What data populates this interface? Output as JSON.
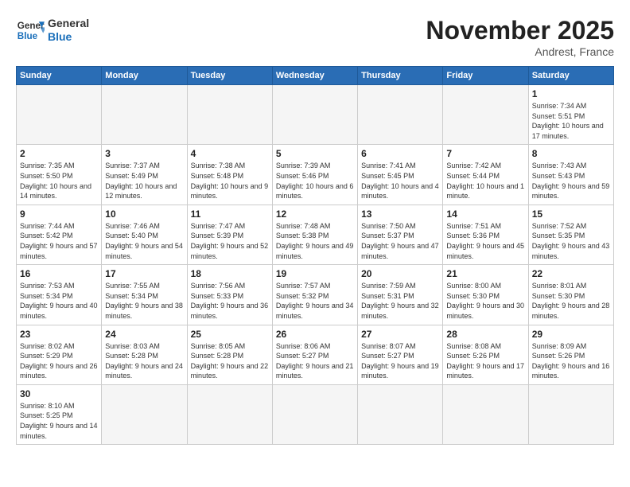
{
  "header": {
    "logo_line1": "General",
    "logo_line2": "Blue",
    "month": "November 2025",
    "location": "Andrest, France"
  },
  "weekdays": [
    "Sunday",
    "Monday",
    "Tuesday",
    "Wednesday",
    "Thursday",
    "Friday",
    "Saturday"
  ],
  "weeks": [
    [
      {
        "day": "",
        "info": ""
      },
      {
        "day": "",
        "info": ""
      },
      {
        "day": "",
        "info": ""
      },
      {
        "day": "",
        "info": ""
      },
      {
        "day": "",
        "info": ""
      },
      {
        "day": "",
        "info": ""
      },
      {
        "day": "1",
        "info": "Sunrise: 7:34 AM\nSunset: 5:51 PM\nDaylight: 10 hours and 17 minutes."
      }
    ],
    [
      {
        "day": "2",
        "info": "Sunrise: 7:35 AM\nSunset: 5:50 PM\nDaylight: 10 hours and 14 minutes."
      },
      {
        "day": "3",
        "info": "Sunrise: 7:37 AM\nSunset: 5:49 PM\nDaylight: 10 hours and 12 minutes."
      },
      {
        "day": "4",
        "info": "Sunrise: 7:38 AM\nSunset: 5:48 PM\nDaylight: 10 hours and 9 minutes."
      },
      {
        "day": "5",
        "info": "Sunrise: 7:39 AM\nSunset: 5:46 PM\nDaylight: 10 hours and 6 minutes."
      },
      {
        "day": "6",
        "info": "Sunrise: 7:41 AM\nSunset: 5:45 PM\nDaylight: 10 hours and 4 minutes."
      },
      {
        "day": "7",
        "info": "Sunrise: 7:42 AM\nSunset: 5:44 PM\nDaylight: 10 hours and 1 minute."
      },
      {
        "day": "8",
        "info": "Sunrise: 7:43 AM\nSunset: 5:43 PM\nDaylight: 9 hours and 59 minutes."
      }
    ],
    [
      {
        "day": "9",
        "info": "Sunrise: 7:44 AM\nSunset: 5:42 PM\nDaylight: 9 hours and 57 minutes."
      },
      {
        "day": "10",
        "info": "Sunrise: 7:46 AM\nSunset: 5:40 PM\nDaylight: 9 hours and 54 minutes."
      },
      {
        "day": "11",
        "info": "Sunrise: 7:47 AM\nSunset: 5:39 PM\nDaylight: 9 hours and 52 minutes."
      },
      {
        "day": "12",
        "info": "Sunrise: 7:48 AM\nSunset: 5:38 PM\nDaylight: 9 hours and 49 minutes."
      },
      {
        "day": "13",
        "info": "Sunrise: 7:50 AM\nSunset: 5:37 PM\nDaylight: 9 hours and 47 minutes."
      },
      {
        "day": "14",
        "info": "Sunrise: 7:51 AM\nSunset: 5:36 PM\nDaylight: 9 hours and 45 minutes."
      },
      {
        "day": "15",
        "info": "Sunrise: 7:52 AM\nSunset: 5:35 PM\nDaylight: 9 hours and 43 minutes."
      }
    ],
    [
      {
        "day": "16",
        "info": "Sunrise: 7:53 AM\nSunset: 5:34 PM\nDaylight: 9 hours and 40 minutes."
      },
      {
        "day": "17",
        "info": "Sunrise: 7:55 AM\nSunset: 5:34 PM\nDaylight: 9 hours and 38 minutes."
      },
      {
        "day": "18",
        "info": "Sunrise: 7:56 AM\nSunset: 5:33 PM\nDaylight: 9 hours and 36 minutes."
      },
      {
        "day": "19",
        "info": "Sunrise: 7:57 AM\nSunset: 5:32 PM\nDaylight: 9 hours and 34 minutes."
      },
      {
        "day": "20",
        "info": "Sunrise: 7:59 AM\nSunset: 5:31 PM\nDaylight: 9 hours and 32 minutes."
      },
      {
        "day": "21",
        "info": "Sunrise: 8:00 AM\nSunset: 5:30 PM\nDaylight: 9 hours and 30 minutes."
      },
      {
        "day": "22",
        "info": "Sunrise: 8:01 AM\nSunset: 5:30 PM\nDaylight: 9 hours and 28 minutes."
      }
    ],
    [
      {
        "day": "23",
        "info": "Sunrise: 8:02 AM\nSunset: 5:29 PM\nDaylight: 9 hours and 26 minutes."
      },
      {
        "day": "24",
        "info": "Sunrise: 8:03 AM\nSunset: 5:28 PM\nDaylight: 9 hours and 24 minutes."
      },
      {
        "day": "25",
        "info": "Sunrise: 8:05 AM\nSunset: 5:28 PM\nDaylight: 9 hours and 22 minutes."
      },
      {
        "day": "26",
        "info": "Sunrise: 8:06 AM\nSunset: 5:27 PM\nDaylight: 9 hours and 21 minutes."
      },
      {
        "day": "27",
        "info": "Sunrise: 8:07 AM\nSunset: 5:27 PM\nDaylight: 9 hours and 19 minutes."
      },
      {
        "day": "28",
        "info": "Sunrise: 8:08 AM\nSunset: 5:26 PM\nDaylight: 9 hours and 17 minutes."
      },
      {
        "day": "29",
        "info": "Sunrise: 8:09 AM\nSunset: 5:26 PM\nDaylight: 9 hours and 16 minutes."
      }
    ],
    [
      {
        "day": "30",
        "info": "Sunrise: 8:10 AM\nSunset: 5:25 PM\nDaylight: 9 hours and 14 minutes."
      },
      {
        "day": "",
        "info": ""
      },
      {
        "day": "",
        "info": ""
      },
      {
        "day": "",
        "info": ""
      },
      {
        "day": "",
        "info": ""
      },
      {
        "day": "",
        "info": ""
      },
      {
        "day": "",
        "info": ""
      }
    ]
  ]
}
